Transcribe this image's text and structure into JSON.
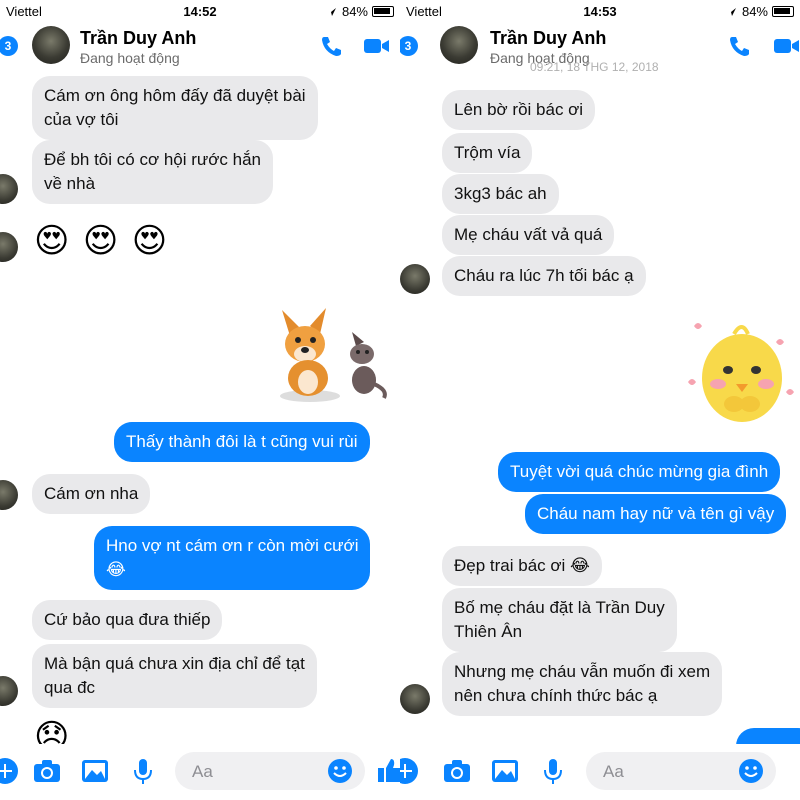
{
  "left": {
    "status": {
      "carrier": "Viettel",
      "time": "14:52",
      "battery": "84%"
    },
    "header": {
      "badge": "3",
      "name": "Trần Duy Anh",
      "status": "Đang hoạt động"
    },
    "messages": [
      "Cám ơn ông hôm đấy đã duyệt bài\ncủa vợ tôi",
      "Để bh tôi có cơ hội rước hắn\nvề nhà",
      "😍 😍 😍",
      "Thấy thành đôi là t cũng vui rùi",
      "Cám ơn nha",
      "Hno vợ nt cám ơn r còn mời cưới\n😂",
      "Cứ bảo qua đưa thiếp",
      "Mà bận quá chưa xin địa chỉ để tạt\nqua đc",
      "😞"
    ],
    "composer": {
      "placeholder": "Aa"
    }
  },
  "right": {
    "status": {
      "carrier": "Viettel",
      "time": "14:53",
      "battery": "84%"
    },
    "header": {
      "badge": "3",
      "name": "Trần Duy Anh",
      "status": "Đang hoạt động"
    },
    "date_peek": "09:21, 18 THG 12, 2018",
    "messages": [
      "Lên bờ rồi bác ơi",
      "Trộm vía",
      "3kg3 bác ah",
      "Mẹ cháu vất vả quá",
      "Cháu ra lúc 7h tối bác ạ",
      "Tuyệt vời quá chúc mừng gia đình",
      "Cháu nam hay nữ và tên gì vậy",
      "Đẹp trai bác ơi 😂",
      "Bố mẹ cháu đặt là Trần Duy\nThiên Ân",
      "Nhưng mẹ cháu vẫn muốn đi xem\nnên chưa chính thức bác ạ"
    ],
    "composer": {
      "placeholder": "Aa"
    }
  },
  "colors": {
    "accent": "#0a84ff",
    "incoming_bubble": "#e9e9eb",
    "outgoing_bubble": "#0a84ff"
  },
  "icons": [
    "wifi-icon",
    "location-icon",
    "battery-icon",
    "phone-icon",
    "video-icon",
    "camera-icon",
    "photo-icon",
    "microphone-icon",
    "emoji-icon",
    "thumbs-up-icon",
    "plus-icon"
  ]
}
